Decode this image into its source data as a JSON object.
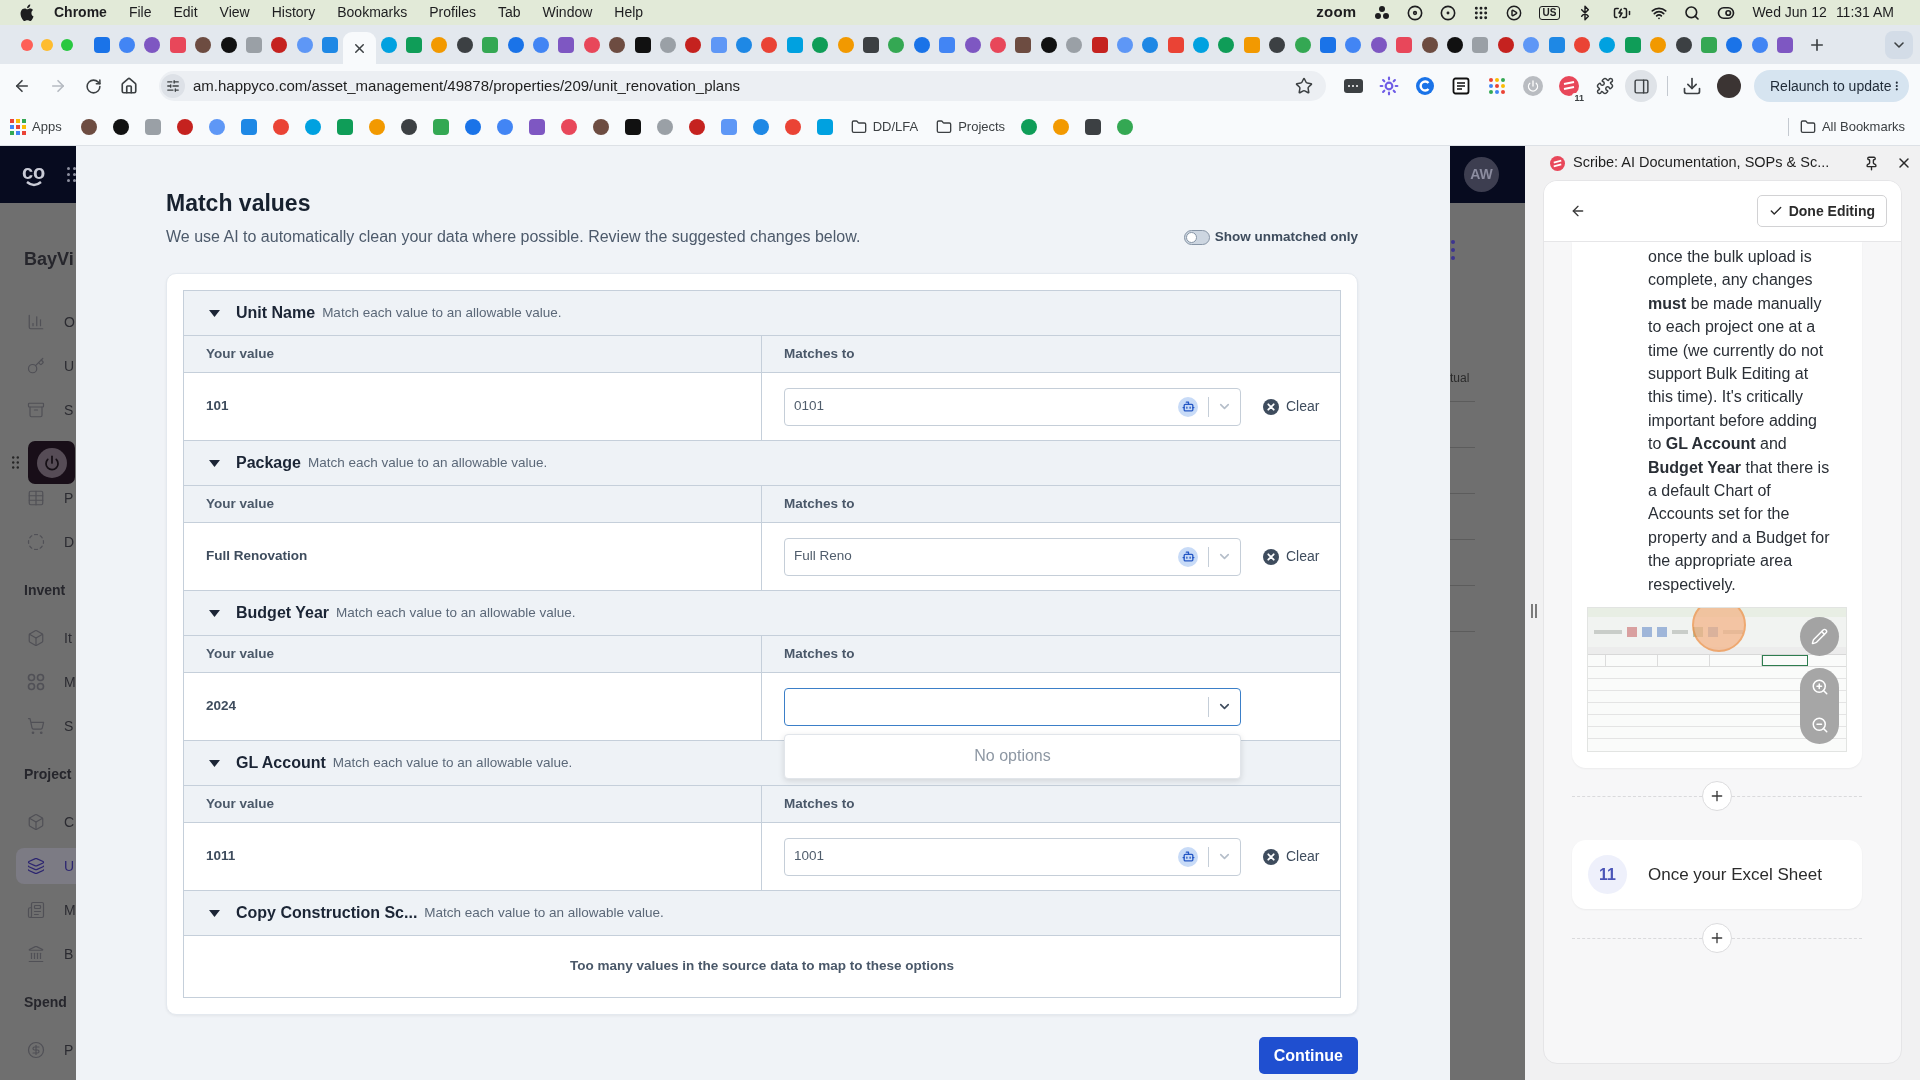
{
  "menu_bar": {
    "app": "Chrome",
    "menus": [
      "File",
      "Edit",
      "View",
      "History",
      "Bookmarks",
      "Profiles",
      "Tab",
      "Window",
      "Help"
    ],
    "status_text": "zoom",
    "input_source": "US",
    "date": "Wed Jun 12",
    "time": "11:31 AM"
  },
  "tabs": [
    {
      "selected": false
    },
    {
      "selected": false
    },
    {
      "selected": false
    },
    {
      "selected": false
    },
    {
      "selected": false
    },
    {
      "selected": false
    },
    {
      "selected": false
    },
    {
      "selected": false
    },
    {
      "selected": false
    },
    {
      "selected": false
    },
    {
      "selected": true
    },
    {
      "selected": false
    },
    {
      "selected": false
    },
    {
      "selected": false
    },
    {
      "selected": false
    },
    {
      "selected": false
    },
    {
      "selected": false
    },
    {
      "selected": false
    },
    {
      "selected": false
    },
    {
      "selected": false
    },
    {
      "selected": false
    },
    {
      "selected": false
    },
    {
      "selected": false
    },
    {
      "selected": false
    },
    {
      "selected": false
    },
    {
      "selected": false
    },
    {
      "selected": false
    },
    {
      "selected": false
    },
    {
      "selected": false
    },
    {
      "selected": false
    },
    {
      "selected": false
    },
    {
      "selected": false
    },
    {
      "selected": false
    },
    {
      "selected": false
    },
    {
      "selected": false
    },
    {
      "selected": false
    },
    {
      "selected": false
    },
    {
      "selected": false
    },
    {
      "selected": false
    },
    {
      "selected": false
    },
    {
      "selected": false
    },
    {
      "selected": false
    },
    {
      "selected": false
    },
    {
      "selected": false
    },
    {
      "selected": false
    },
    {
      "selected": false
    },
    {
      "selected": false
    },
    {
      "selected": false
    },
    {
      "selected": false
    },
    {
      "selected": false
    },
    {
      "selected": false
    },
    {
      "selected": false
    },
    {
      "selected": false
    },
    {
      "selected": false
    },
    {
      "selected": false
    },
    {
      "selected": false
    },
    {
      "selected": false
    },
    {
      "selected": false
    },
    {
      "selected": false
    },
    {
      "selected": false
    },
    {
      "selected": false
    },
    {
      "selected": false
    },
    {
      "selected": false
    },
    {
      "selected": false
    },
    {
      "selected": false
    },
    {
      "selected": false
    },
    {
      "selected": false
    }
  ],
  "toolbar": {
    "forward_disabled": true,
    "url": "am.happyco.com/asset_management/49878/properties/209/unit_renovation_plans",
    "extension_badge": "11",
    "relaunch_button": "Relaunch to update"
  },
  "bookmarks": [
    {
      "kind": "apps",
      "label": "Apps"
    },
    {
      "kind": "icon"
    },
    {
      "kind": "icon"
    },
    {
      "kind": "icon"
    },
    {
      "kind": "icon"
    },
    {
      "kind": "icon"
    },
    {
      "kind": "icon"
    },
    {
      "kind": "icon"
    },
    {
      "kind": "icon"
    },
    {
      "kind": "icon"
    },
    {
      "kind": "icon"
    },
    {
      "kind": "icon"
    },
    {
      "kind": "icon"
    },
    {
      "kind": "icon"
    },
    {
      "kind": "icon"
    },
    {
      "kind": "icon"
    },
    {
      "kind": "icon"
    },
    {
      "kind": "icon"
    },
    {
      "kind": "icon"
    },
    {
      "kind": "icon"
    },
    {
      "kind": "icon"
    },
    {
      "kind": "icon"
    },
    {
      "kind": "icon"
    },
    {
      "kind": "icon"
    },
    {
      "kind": "icon"
    },
    {
      "kind": "folder",
      "label": "DD/LFA"
    },
    {
      "kind": "folder",
      "label": "Projects"
    },
    {
      "kind": "icon"
    },
    {
      "kind": "icon"
    },
    {
      "kind": "icon"
    },
    {
      "kind": "icon"
    }
  ],
  "all_bookmarks": "All Bookmarks",
  "app": {
    "logo": "co",
    "avatar": "AW",
    "property_title": "BayVi",
    "sidebar": [
      {
        "kind": "item",
        "label": "O",
        "selected": false
      },
      {
        "kind": "item",
        "label": "U",
        "selected": false
      },
      {
        "kind": "item",
        "label": "S",
        "selected": false
      },
      {
        "kind": "item",
        "label": "P",
        "selected": false
      },
      {
        "kind": "item",
        "label": "D",
        "selected": false
      },
      {
        "kind": "section",
        "label": "Invent"
      },
      {
        "kind": "item",
        "label": "It",
        "selected": false
      },
      {
        "kind": "item",
        "label": "M",
        "selected": false
      },
      {
        "kind": "item",
        "label": "S",
        "selected": false
      },
      {
        "kind": "section",
        "label": "Project"
      },
      {
        "kind": "item",
        "label": "C",
        "selected": false
      },
      {
        "kind": "item",
        "label": "U",
        "selected": true
      },
      {
        "kind": "item",
        "label": "M",
        "selected": false
      },
      {
        "kind": "item",
        "label": "B",
        "selected": false
      },
      {
        "kind": "section",
        "label": "Spend"
      },
      {
        "kind": "item",
        "label": "P",
        "selected": false
      }
    ],
    "table_fragment": "tual"
  },
  "dialog": {
    "title": "Match values",
    "subtitle": "We use AI to automatically clean your data where possible. Review the suggested changes below.",
    "unmatched_toggle": {
      "label": "Show unmatched only",
      "on": false
    },
    "sections": [
      {
        "name": "Unit Name",
        "hint": "Match each value to an allowable value.",
        "expanded": true,
        "columns": [
          "Your value",
          "Matches to"
        ],
        "rows": [
          {
            "value": "101",
            "match": "0101",
            "ai_suggested": true,
            "focused": false,
            "clear": "Clear"
          }
        ]
      },
      {
        "name": "Package",
        "hint": "Match each value to an allowable value.",
        "expanded": true,
        "columns": [
          "Your value",
          "Matches to"
        ],
        "rows": [
          {
            "value": "Full Renovation",
            "match": "Full Reno",
            "ai_suggested": true,
            "focused": false,
            "clear": "Clear"
          }
        ]
      },
      {
        "name": "Budget Year",
        "hint": "Match each value to an allowable value.",
        "expanded": true,
        "columns": [
          "Your value",
          "Matches to"
        ],
        "rows": [
          {
            "value": "2024",
            "ai_suggested": false,
            "focused": true,
            "menu_message": "No options"
          }
        ]
      },
      {
        "name": "GL Account",
        "hint": "Match each value to an allowable value.",
        "expanded": true,
        "columns": [
          "Your value",
          "Matches to"
        ],
        "rows": [
          {
            "value": "1011",
            "match": "1001",
            "ai_suggested": true,
            "focused": false,
            "clear": "Clear"
          }
        ]
      },
      {
        "name": "Copy Construction Sc...",
        "hint": "Match each value to an allowable value.",
        "expanded": true,
        "message": "Too many values in the source data to map to these options"
      }
    ],
    "primary_button": "Continue"
  },
  "side_panel": {
    "title": "Scribe: AI Documentation, SOPs & Sc...",
    "done_button": "Done Editing",
    "step_text": "once the bulk upload is complete, any changes **must** be made manually to each project one at a time (we currently do not support Bulk Editing at this time). It's critically important before adding to **GL Account** and **Budget Year** that there is a default Chart of Accounts set for the property and a Budget for the appropriate area respectively.",
    "next_step": {
      "number": "11",
      "text": "Once your Excel Sheet"
    }
  }
}
